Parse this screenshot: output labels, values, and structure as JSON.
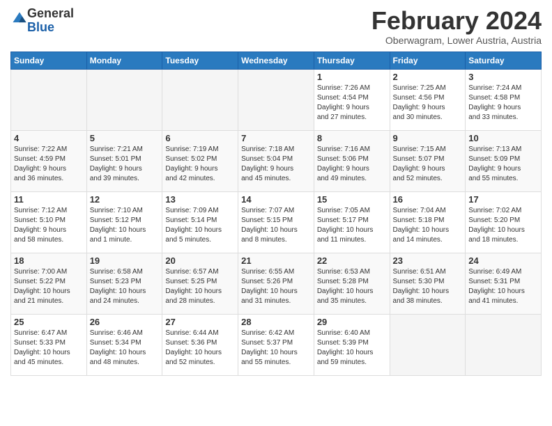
{
  "logo": {
    "general": "General",
    "blue": "Blue"
  },
  "header": {
    "month_title": "February 2024",
    "location": "Oberwagram, Lower Austria, Austria"
  },
  "days_of_week": [
    "Sunday",
    "Monday",
    "Tuesday",
    "Wednesday",
    "Thursday",
    "Friday",
    "Saturday"
  ],
  "weeks": [
    [
      {
        "num": "",
        "info": ""
      },
      {
        "num": "",
        "info": ""
      },
      {
        "num": "",
        "info": ""
      },
      {
        "num": "",
        "info": ""
      },
      {
        "num": "1",
        "info": "Sunrise: 7:26 AM\nSunset: 4:54 PM\nDaylight: 9 hours\nand 27 minutes."
      },
      {
        "num": "2",
        "info": "Sunrise: 7:25 AM\nSunset: 4:56 PM\nDaylight: 9 hours\nand 30 minutes."
      },
      {
        "num": "3",
        "info": "Sunrise: 7:24 AM\nSunset: 4:58 PM\nDaylight: 9 hours\nand 33 minutes."
      }
    ],
    [
      {
        "num": "4",
        "info": "Sunrise: 7:22 AM\nSunset: 4:59 PM\nDaylight: 9 hours\nand 36 minutes."
      },
      {
        "num": "5",
        "info": "Sunrise: 7:21 AM\nSunset: 5:01 PM\nDaylight: 9 hours\nand 39 minutes."
      },
      {
        "num": "6",
        "info": "Sunrise: 7:19 AM\nSunset: 5:02 PM\nDaylight: 9 hours\nand 42 minutes."
      },
      {
        "num": "7",
        "info": "Sunrise: 7:18 AM\nSunset: 5:04 PM\nDaylight: 9 hours\nand 45 minutes."
      },
      {
        "num": "8",
        "info": "Sunrise: 7:16 AM\nSunset: 5:06 PM\nDaylight: 9 hours\nand 49 minutes."
      },
      {
        "num": "9",
        "info": "Sunrise: 7:15 AM\nSunset: 5:07 PM\nDaylight: 9 hours\nand 52 minutes."
      },
      {
        "num": "10",
        "info": "Sunrise: 7:13 AM\nSunset: 5:09 PM\nDaylight: 9 hours\nand 55 minutes."
      }
    ],
    [
      {
        "num": "11",
        "info": "Sunrise: 7:12 AM\nSunset: 5:10 PM\nDaylight: 9 hours\nand 58 minutes."
      },
      {
        "num": "12",
        "info": "Sunrise: 7:10 AM\nSunset: 5:12 PM\nDaylight: 10 hours\nand 1 minute."
      },
      {
        "num": "13",
        "info": "Sunrise: 7:09 AM\nSunset: 5:14 PM\nDaylight: 10 hours\nand 5 minutes."
      },
      {
        "num": "14",
        "info": "Sunrise: 7:07 AM\nSunset: 5:15 PM\nDaylight: 10 hours\nand 8 minutes."
      },
      {
        "num": "15",
        "info": "Sunrise: 7:05 AM\nSunset: 5:17 PM\nDaylight: 10 hours\nand 11 minutes."
      },
      {
        "num": "16",
        "info": "Sunrise: 7:04 AM\nSunset: 5:18 PM\nDaylight: 10 hours\nand 14 minutes."
      },
      {
        "num": "17",
        "info": "Sunrise: 7:02 AM\nSunset: 5:20 PM\nDaylight: 10 hours\nand 18 minutes."
      }
    ],
    [
      {
        "num": "18",
        "info": "Sunrise: 7:00 AM\nSunset: 5:22 PM\nDaylight: 10 hours\nand 21 minutes."
      },
      {
        "num": "19",
        "info": "Sunrise: 6:58 AM\nSunset: 5:23 PM\nDaylight: 10 hours\nand 24 minutes."
      },
      {
        "num": "20",
        "info": "Sunrise: 6:57 AM\nSunset: 5:25 PM\nDaylight: 10 hours\nand 28 minutes."
      },
      {
        "num": "21",
        "info": "Sunrise: 6:55 AM\nSunset: 5:26 PM\nDaylight: 10 hours\nand 31 minutes."
      },
      {
        "num": "22",
        "info": "Sunrise: 6:53 AM\nSunset: 5:28 PM\nDaylight: 10 hours\nand 35 minutes."
      },
      {
        "num": "23",
        "info": "Sunrise: 6:51 AM\nSunset: 5:30 PM\nDaylight: 10 hours\nand 38 minutes."
      },
      {
        "num": "24",
        "info": "Sunrise: 6:49 AM\nSunset: 5:31 PM\nDaylight: 10 hours\nand 41 minutes."
      }
    ],
    [
      {
        "num": "25",
        "info": "Sunrise: 6:47 AM\nSunset: 5:33 PM\nDaylight: 10 hours\nand 45 minutes."
      },
      {
        "num": "26",
        "info": "Sunrise: 6:46 AM\nSunset: 5:34 PM\nDaylight: 10 hours\nand 48 minutes."
      },
      {
        "num": "27",
        "info": "Sunrise: 6:44 AM\nSunset: 5:36 PM\nDaylight: 10 hours\nand 52 minutes."
      },
      {
        "num": "28",
        "info": "Sunrise: 6:42 AM\nSunset: 5:37 PM\nDaylight: 10 hours\nand 55 minutes."
      },
      {
        "num": "29",
        "info": "Sunrise: 6:40 AM\nSunset: 5:39 PM\nDaylight: 10 hours\nand 59 minutes."
      },
      {
        "num": "",
        "info": ""
      },
      {
        "num": "",
        "info": ""
      }
    ]
  ]
}
